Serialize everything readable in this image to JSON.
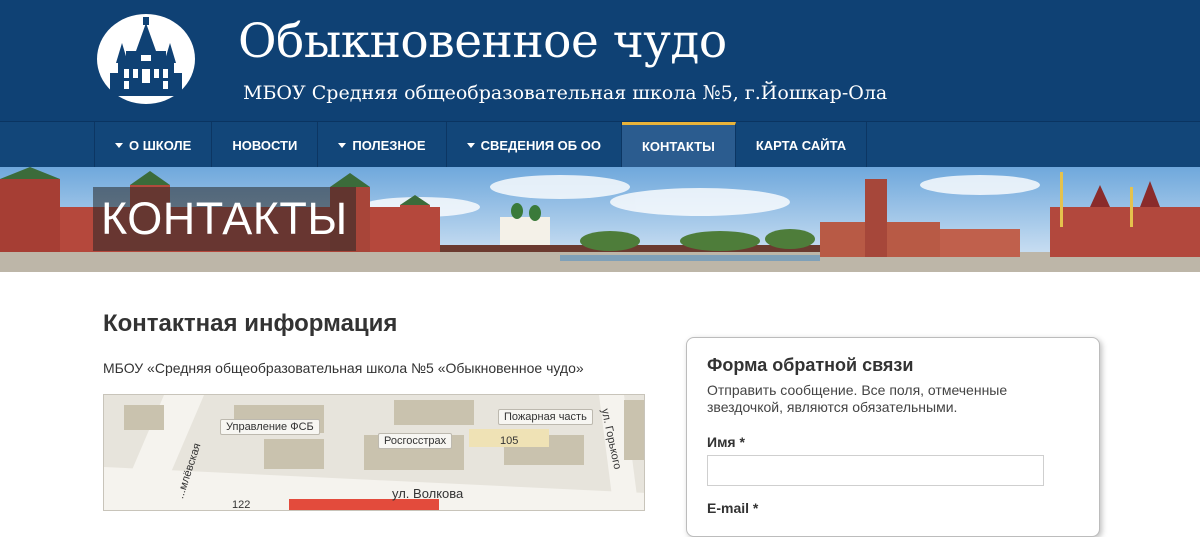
{
  "header": {
    "title": "Обыкновенное чудо",
    "subtitle": "МБОУ Средняя общеобразовательная школа №5, г.Йошкар-Ола",
    "logo_icon": "school-building-logo-icon"
  },
  "nav": {
    "items": [
      {
        "label": "О ШКОЛЕ",
        "has_dropdown": true
      },
      {
        "label": "НОВОСТИ",
        "has_dropdown": false
      },
      {
        "label": "ПОЛЕЗНОЕ",
        "has_dropdown": true
      },
      {
        "label": "СВЕДЕНИЯ ОБ ОО",
        "has_dropdown": true
      },
      {
        "label": "КОНТАКТЫ",
        "has_dropdown": false,
        "active": true
      },
      {
        "label": "КАРТА САЙТА",
        "has_dropdown": false
      }
    ],
    "active_accent": "#e9b33a"
  },
  "banner": {
    "title": "КОНТАКТЫ"
  },
  "content": {
    "title": "Контактная информация",
    "school_name": "МБОУ «Средняя общеобразовательная школа №5 «Обыкновенное чудо»"
  },
  "map": {
    "labels": {
      "fsb": "Управление ФСБ",
      "fire": "Пожарная часть",
      "rosgos": "Росгосстрах",
      "num105": "105",
      "num122": "122"
    },
    "streets": {
      "volkova": "ул. Волкова",
      "gorkogo": "ул. Горького",
      "pervomaiskaya": "...млёвская"
    }
  },
  "form": {
    "title": "Форма обратной связи",
    "description": "Отправить сообщение. Все поля, отмеченные звездочкой, являются обязательными.",
    "name_label": "Имя *",
    "email_label": "E-mail *"
  },
  "colors": {
    "header_bg": "#0f4174",
    "nav_bg": "#124679",
    "nav_active_bg": "#2b5c8f"
  }
}
